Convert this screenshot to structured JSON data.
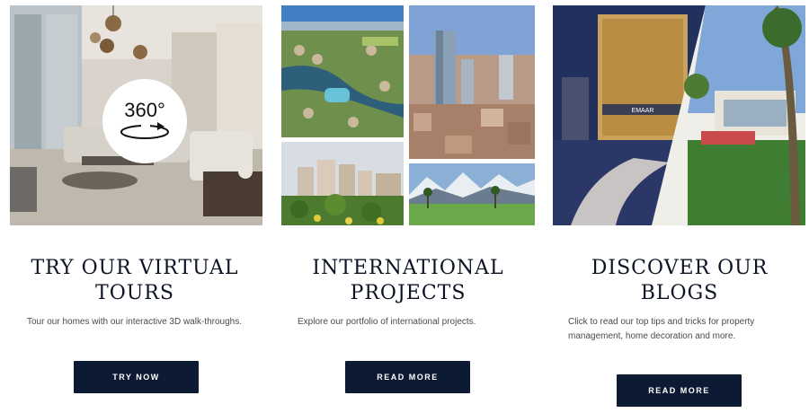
{
  "cards": [
    {
      "title_line1": "TRY OUR VIRTUAL",
      "title_line2": "TOURS",
      "description": "Tour our homes with our interactive 3D walk-throughs.",
      "button": "TRY NOW",
      "badge": "360°"
    },
    {
      "title_line1": "INTERNATIONAL",
      "title_line2": "PROJECTS",
      "description": "Explore our portfolio of international projects.",
      "button": "READ MORE"
    },
    {
      "title_line1": "DISCOVER OUR",
      "title_line2": "BLOGS",
      "description": "Click to read our top tips and tricks for property management, home decoration and more.",
      "button": "READ MORE",
      "photo_sign": "EMAAR"
    }
  ],
  "colors": {
    "button_bg": "#0c1a33",
    "title": "#0c1324",
    "text": "#4a4a4a"
  }
}
